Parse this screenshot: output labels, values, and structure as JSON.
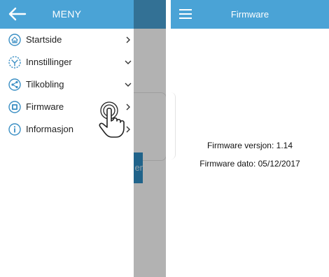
{
  "left": {
    "drawer": {
      "title": "MENY",
      "items": [
        {
          "label": "Startside",
          "icon": "home-icon",
          "chevron": "right"
        },
        {
          "label": "Innstillinger",
          "icon": "settings-icon",
          "chevron": "down"
        },
        {
          "label": "Tilkobling",
          "icon": "share-icon",
          "chevron": "down"
        },
        {
          "label": "Firmware",
          "icon": "firmware-icon",
          "chevron": "right"
        },
        {
          "label": "Informasjon",
          "icon": "info-icon",
          "chevron": "right"
        }
      ]
    },
    "background_button_fragment": "er"
  },
  "right": {
    "header": {
      "title": "Firmware"
    },
    "firmware_version": "Firmware versjon: 1.14",
    "firmware_date": "Firmware dato: 05/12/2017"
  },
  "colors": {
    "header": "#4aa3d6",
    "icon": "#3b8fc4",
    "overlay": "#a9a9a9"
  }
}
